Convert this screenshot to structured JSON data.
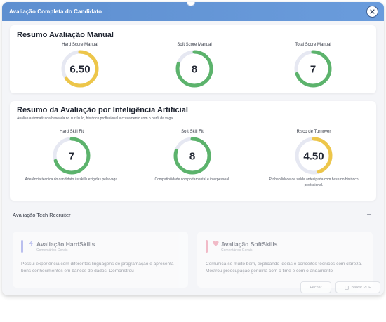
{
  "modal": {
    "title": "Avaliação Completa do Candidato"
  },
  "manual": {
    "title": "Resumo Avaliação Manual",
    "metrics": [
      {
        "label": "Hard Score Manual",
        "value": "6.50",
        "fraction": 0.65,
        "color": "#edc64a"
      },
      {
        "label": "Soft Score Manual",
        "value": "8",
        "fraction": 0.8,
        "color": "#5cb36c"
      },
      {
        "label": "Total Score Manual",
        "value": "7",
        "fraction": 0.7,
        "color": "#5cb36c"
      }
    ]
  },
  "ai": {
    "title": "Resumo da Avaliação por Inteligência Artificial",
    "subtitle": "Análise automatizada baseada no currículo, histórico profissional e cruzamento com o perfil da vaga.",
    "metrics": [
      {
        "label": "Hard Skill Fit",
        "value": "7",
        "fraction": 0.7,
        "color": "#5cb36c",
        "desc": "Aderência técnica do candidato às skills exigidas pela vaga."
      },
      {
        "label": "Soft Skill Fit",
        "value": "8",
        "fraction": 0.8,
        "color": "#5cb36c",
        "desc": "Compatibilidade comportamental e interpessoal."
      },
      {
        "label": "Risco de Turnover",
        "value": "4.50",
        "fraction": 0.45,
        "color": "#edc64a",
        "desc": "Probabilidade de saída antecipada com base no histórico profissional."
      }
    ]
  },
  "recruiter": {
    "title": "Avaliação Tech Recruiter",
    "hard": {
      "title": "Avaliação HardSkills",
      "subtitle": "Comentários Gerais",
      "text": "Possui experiência com diferentes linguagens de programação e apresenta bons conhecimentos em bancos de dados. Demonstrou",
      "accent": "#8b93e6"
    },
    "soft": {
      "title": "Avaliação SoftSkills",
      "subtitle": "Comentários Gerais",
      "text": "Comunica-se muito bem, explicando ideias e conceitos técnicos com clareza. Mostrou preocupação genuína com o time e com o andamento",
      "accent": "#f08aa0"
    }
  },
  "footer": {
    "close_label": "Fechar",
    "pdf_label": "Baixar PDF"
  },
  "colors": {
    "header": "#5e8fd0",
    "track": "#e6e8f2",
    "green": "#5cb36c",
    "yellow": "#edc64a"
  }
}
